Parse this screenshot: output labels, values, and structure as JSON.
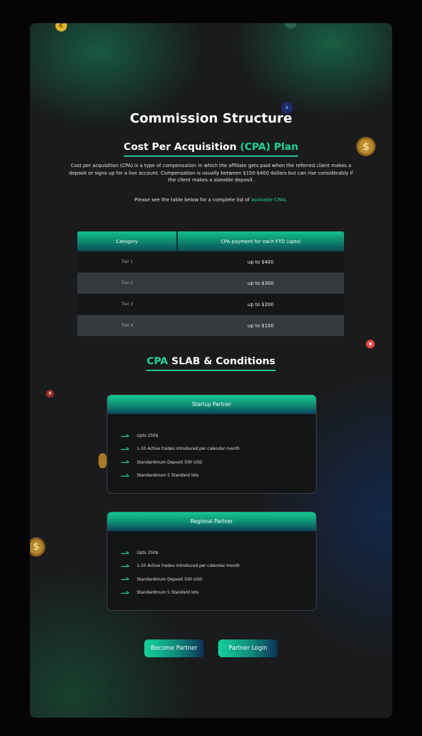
{
  "page_title": "Commission Structure",
  "cpa_heading": {
    "main": "Cost Per Acquisition",
    "accent": "(CPA) Plan"
  },
  "intro_text": "Cost per acquisition (CPA) is a type of compensation in which the affiliate gets paid when the referred client makes a deposit or signs up for a live account. Compensation is usually between $150-$400 dollars but can rise considerably if the client makes a sizeable deposit.",
  "note": {
    "text": "Please see the table below for a complete list of",
    "link": "available CPAs."
  },
  "table": {
    "headers": [
      "Category",
      "CPA payment for each FTD (upto)"
    ],
    "rows": [
      {
        "category": "Tier 1",
        "payment": "up to $400"
      },
      {
        "category": "Tier 2",
        "payment": "up to $300"
      },
      {
        "category": "Tier 3",
        "payment": "up to $200"
      },
      {
        "category": "Tier 4",
        "payment": "up to $150"
      }
    ]
  },
  "slab_heading": {
    "accent": "CPA",
    "main": "SLAB & Conditions"
  },
  "cards": [
    {
      "title": "Startup Partner",
      "items": [
        "Upto 250$",
        "1-10 Active trades introduced per calendar month",
        "Standardmum Deposit 500 USD",
        "Standardmum 5 Standard lots"
      ]
    },
    {
      "title": "Regional Partner",
      "items": [
        "Upto 250$",
        "1-10 Active trades introduced per calendar month",
        "Standardmum Deposit 500 USD",
        "Standardmum 5 Standard lots"
      ]
    }
  ],
  "buttons": {
    "become_partner": "Become Partner",
    "partner_login": "Partner Login"
  },
  "decor": {
    "coin_symbols": {
      "euro": "€",
      "dollar": "$",
      "yen": "¥",
      "eth": "♦"
    },
    "icons": [
      "euro-coin-icon",
      "dollar-coin-icon",
      "yen-coin-icon",
      "ethereum-coin-icon",
      "arrow-right-icon"
    ]
  },
  "colors": {
    "accent": "#1fd49a",
    "panel": "#1a1b1c",
    "row_dark": "#151617",
    "row_light": "#363a3f"
  }
}
